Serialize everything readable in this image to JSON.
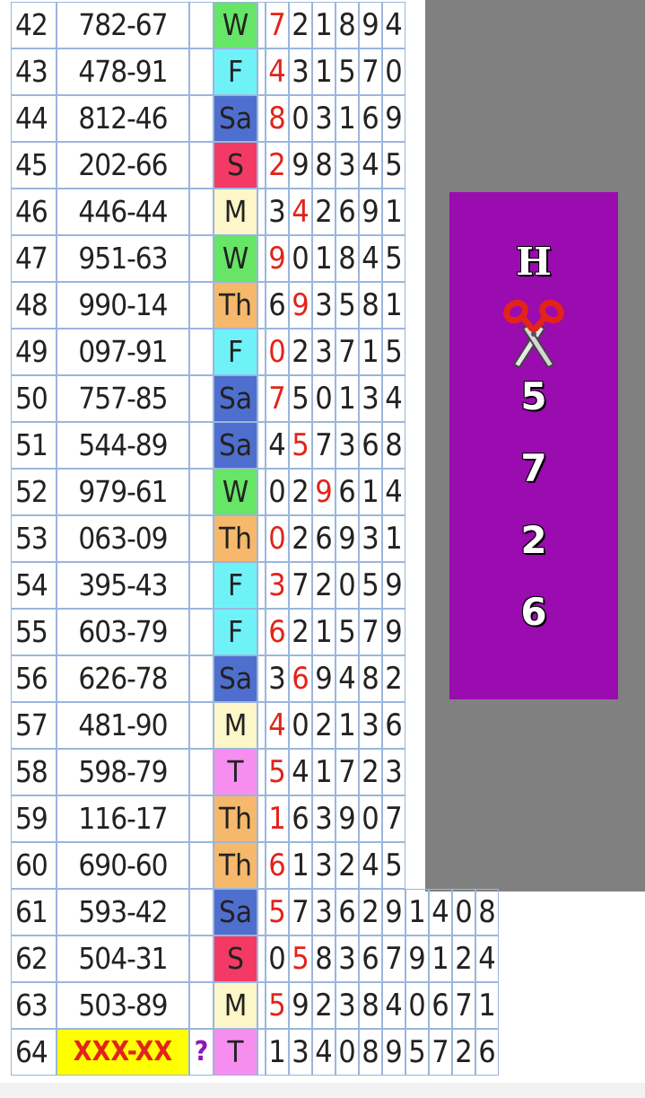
{
  "day_colors": {
    "W": "#66e566",
    "F": "#6ef2f7",
    "Sa": "#4f6fcf",
    "S": "#f23a64",
    "M": "#fdf6c8",
    "Th": "#f6b86b",
    "T": "#f68ef0"
  },
  "rows": [
    {
      "num": "42",
      "result": "782-67",
      "day": "W",
      "digits": [
        "7",
        "2",
        "1",
        "8",
        "9",
        "4"
      ],
      "red": [
        0
      ]
    },
    {
      "num": "43",
      "result": "478-91",
      "day": "F",
      "digits": [
        "4",
        "3",
        "1",
        "5",
        "7",
        "0"
      ],
      "red": [
        0
      ]
    },
    {
      "num": "44",
      "result": "812-46",
      "day": "Sa",
      "digits": [
        "8",
        "0",
        "3",
        "1",
        "6",
        "9"
      ],
      "red": [
        0
      ]
    },
    {
      "num": "45",
      "result": "202-66",
      "day": "S",
      "digits": [
        "2",
        "9",
        "8",
        "3",
        "4",
        "5"
      ],
      "red": [
        0
      ]
    },
    {
      "num": "46",
      "result": "446-44",
      "day": "M",
      "digits": [
        "3",
        "4",
        "2",
        "6",
        "9",
        "1"
      ],
      "red": [
        1
      ]
    },
    {
      "num": "47",
      "result": "951-63",
      "day": "W",
      "digits": [
        "9",
        "0",
        "1",
        "8",
        "4",
        "5"
      ],
      "red": [
        0
      ]
    },
    {
      "num": "48",
      "result": "990-14",
      "day": "Th",
      "digits": [
        "6",
        "9",
        "3",
        "5",
        "8",
        "1"
      ],
      "red": [
        1
      ]
    },
    {
      "num": "49",
      "result": "097-91",
      "day": "F",
      "digits": [
        "0",
        "2",
        "3",
        "7",
        "1",
        "5"
      ],
      "red": [
        0
      ]
    },
    {
      "num": "50",
      "result": "757-85",
      "day": "Sa",
      "digits": [
        "7",
        "5",
        "0",
        "1",
        "3",
        "4"
      ],
      "red": [
        0
      ]
    },
    {
      "num": "51",
      "result": "544-89",
      "day": "Sa",
      "digits": [
        "4",
        "5",
        "7",
        "3",
        "6",
        "8"
      ],
      "red": [
        1
      ]
    },
    {
      "num": "52",
      "result": "979-61",
      "day": "W",
      "digits": [
        "0",
        "2",
        "9",
        "6",
        "1",
        "4"
      ],
      "red": [
        2
      ]
    },
    {
      "num": "53",
      "result": "063-09",
      "day": "Th",
      "digits": [
        "0",
        "2",
        "6",
        "9",
        "3",
        "1"
      ],
      "red": [
        0
      ]
    },
    {
      "num": "54",
      "result": "395-43",
      "day": "F",
      "digits": [
        "3",
        "7",
        "2",
        "0",
        "5",
        "9"
      ],
      "red": [
        0
      ]
    },
    {
      "num": "55",
      "result": "603-79",
      "day": "F",
      "digits": [
        "6",
        "2",
        "1",
        "5",
        "7",
        "9"
      ],
      "red": [
        0
      ]
    },
    {
      "num": "56",
      "result": "626-78",
      "day": "Sa",
      "digits": [
        "3",
        "6",
        "9",
        "4",
        "8",
        "2"
      ],
      "red": [
        1
      ]
    },
    {
      "num": "57",
      "result": "481-90",
      "day": "M",
      "digits": [
        "4",
        "0",
        "2",
        "1",
        "3",
        "6"
      ],
      "red": [
        0
      ]
    },
    {
      "num": "58",
      "result": "598-79",
      "day": "T",
      "digits": [
        "5",
        "4",
        "1",
        "7",
        "2",
        "3"
      ],
      "red": [
        0
      ]
    },
    {
      "num": "59",
      "result": "116-17",
      "day": "Th",
      "digits": [
        "1",
        "6",
        "3",
        "9",
        "0",
        "7"
      ],
      "red": [
        0
      ]
    },
    {
      "num": "60",
      "result": "690-60",
      "day": "Th",
      "digits": [
        "6",
        "1",
        "3",
        "2",
        "4",
        "5"
      ],
      "red": [
        0
      ]
    },
    {
      "num": "61",
      "result": "593-42",
      "day": "Sa",
      "digits": [
        "5",
        "7",
        "3",
        "6",
        "2",
        "9",
        "1",
        "4",
        "0",
        "8"
      ],
      "red": [
        0
      ]
    },
    {
      "num": "62",
      "result": "504-31",
      "day": "S",
      "digits": [
        "0",
        "5",
        "8",
        "3",
        "6",
        "7",
        "9",
        "1",
        "2",
        "4"
      ],
      "red": [
        1
      ]
    },
    {
      "num": "63",
      "result": "503-89",
      "day": "M",
      "digits": [
        "5",
        "9",
        "2",
        "3",
        "8",
        "4",
        "0",
        "6",
        "7",
        "1"
      ],
      "red": [
        0
      ]
    },
    {
      "num": "64",
      "result": "XXX-XX",
      "day": "T",
      "digits": [
        "1",
        "3",
        "4",
        "0",
        "8",
        "9",
        "5",
        "7",
        "2",
        "6"
      ],
      "red": [],
      "placeholder": true,
      "question": "?"
    }
  ],
  "prediction": {
    "letter": "H",
    "icon": "scissors-icon",
    "digits": [
      "5",
      "7",
      "2",
      "6"
    ]
  }
}
